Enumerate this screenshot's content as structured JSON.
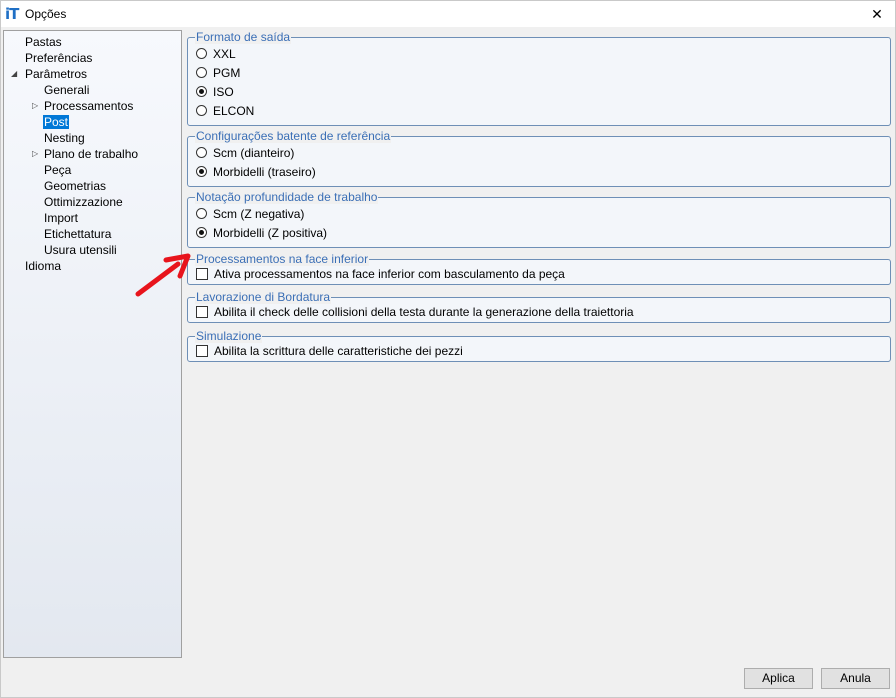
{
  "window": {
    "title": "Opções",
    "close_glyph": "✕"
  },
  "tree": {
    "items": [
      {
        "label": "Pastas"
      },
      {
        "label": "Preferências"
      },
      {
        "label": "Parâmetros"
      },
      {
        "label": "Generali"
      },
      {
        "label": "Processamentos"
      },
      {
        "label": "Post"
      },
      {
        "label": "Nesting"
      },
      {
        "label": "Plano de trabalho"
      },
      {
        "label": "Peça"
      },
      {
        "label": "Geometrias"
      },
      {
        "label": "Ottimizzazione"
      },
      {
        "label": "Import"
      },
      {
        "label": "Etichettatura"
      },
      {
        "label": "Usura utensili"
      },
      {
        "label": "Idioma"
      }
    ],
    "selected": "Post"
  },
  "groups": {
    "output_format": {
      "title": "Formato de saída",
      "options": [
        "XXL",
        "PGM",
        "ISO",
        "ELCON"
      ],
      "selected": "ISO"
    },
    "reference_stop": {
      "title": "Configurações batente de referência",
      "options": [
        "Scm (dianteiro)",
        "Morbidelli (traseiro)"
      ],
      "selected": "Morbidelli (traseiro)"
    },
    "depth_notation": {
      "title": "Notação profundidade de trabalho",
      "options": [
        "Scm (Z negativa)",
        "Morbidelli (Z positiva)"
      ],
      "selected": "Morbidelli (Z positiva)"
    },
    "lower_face": {
      "title": "Processamentos na face inferior",
      "checkbox": "Ativa processamentos na face inferior com basculamento da peça",
      "checked": false
    },
    "edging": {
      "title": "Lavorazione di Bordatura",
      "checkbox": "Abilita il check delle collisioni della testa durante la generazione della traiettoria",
      "checked": false
    },
    "simulation": {
      "title": "Simulazione",
      "checkbox": "Abilita la scrittura delle caratteristiche dei pezzi",
      "checked": false
    }
  },
  "buttons": {
    "apply": "Aplica",
    "cancel": "Anula"
  },
  "colors": {
    "accent": "#0078d7",
    "group_title": "#3b6fb6",
    "annotation_arrow": "#e8141c"
  }
}
